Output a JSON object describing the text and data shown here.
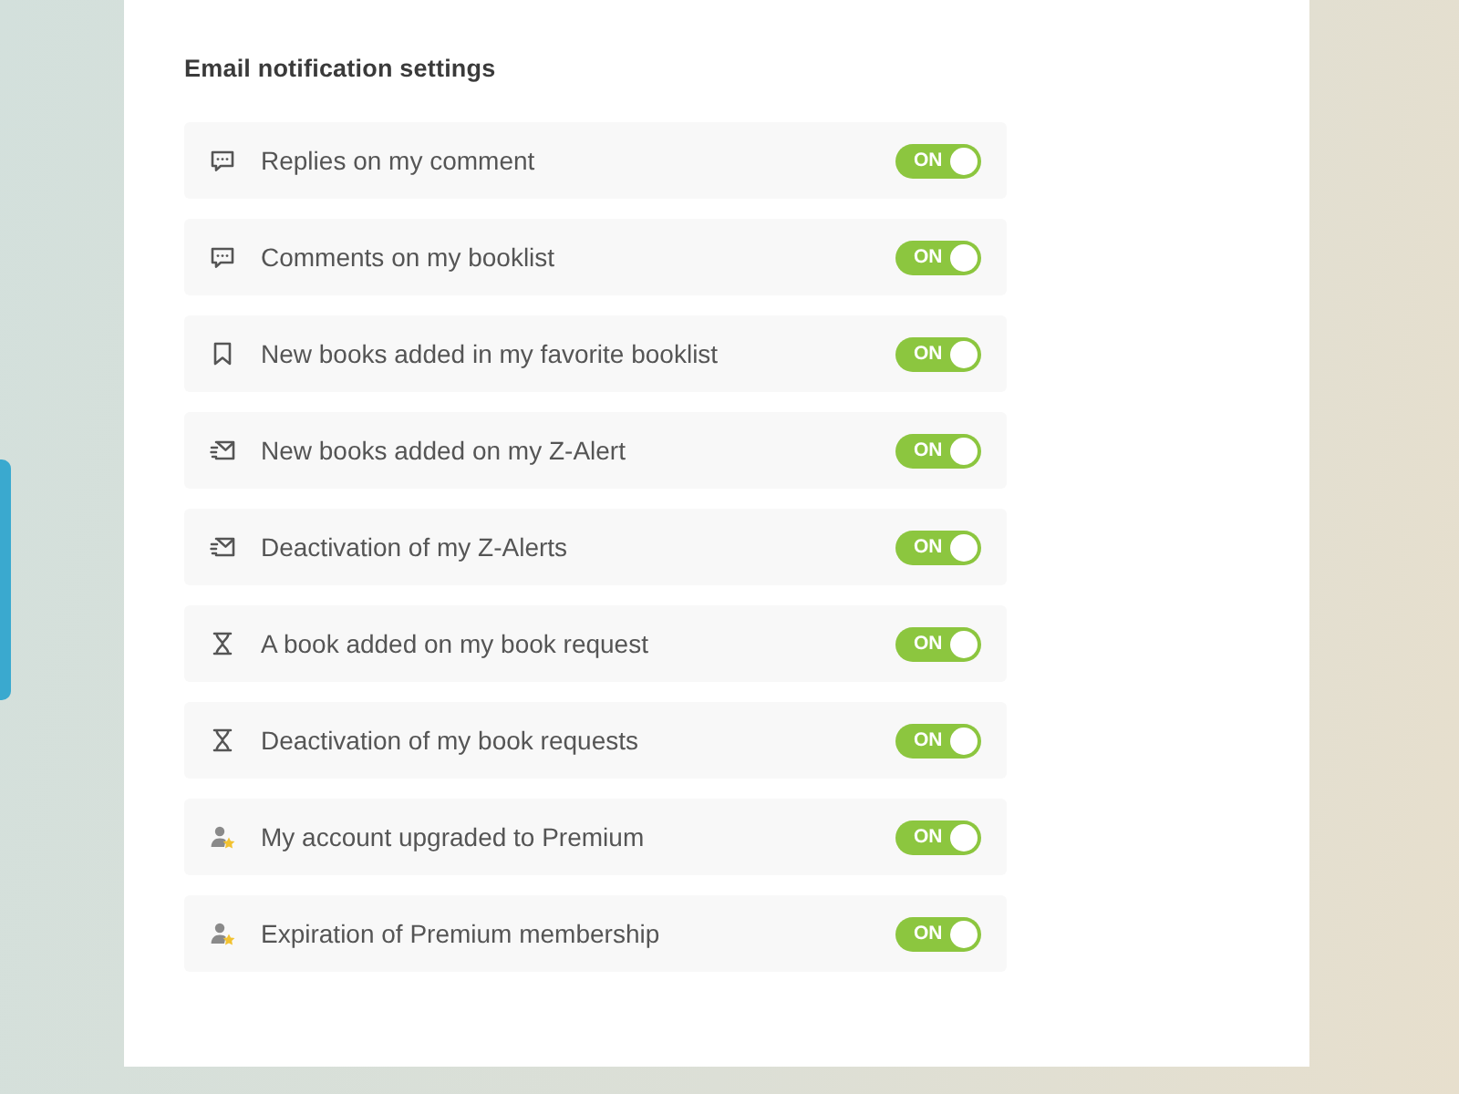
{
  "section": {
    "title": "Email notification settings"
  },
  "settings": [
    {
      "kind": "comment",
      "label": "Replies on my comment",
      "on": true,
      "toggle_label": "ON"
    },
    {
      "kind": "comment",
      "label": "Comments on my booklist",
      "on": true,
      "toggle_label": "ON"
    },
    {
      "kind": "bookmark",
      "label": "New books added in my favorite booklist",
      "on": true,
      "toggle_label": "ON"
    },
    {
      "kind": "mail",
      "label": "New books added on my Z-Alert",
      "on": true,
      "toggle_label": "ON"
    },
    {
      "kind": "mail",
      "label": "Deactivation of my Z-Alerts",
      "on": true,
      "toggle_label": "ON"
    },
    {
      "kind": "hourglass",
      "label": "A book added on my book request",
      "on": true,
      "toggle_label": "ON"
    },
    {
      "kind": "hourglass",
      "label": "Deactivation of my book requests",
      "on": true,
      "toggle_label": "ON"
    },
    {
      "kind": "user",
      "label": "My account upgraded to Premium",
      "on": true,
      "toggle_label": "ON"
    },
    {
      "kind": "user",
      "label": "Expiration of Premium membership",
      "on": true,
      "toggle_label": "ON"
    }
  ]
}
